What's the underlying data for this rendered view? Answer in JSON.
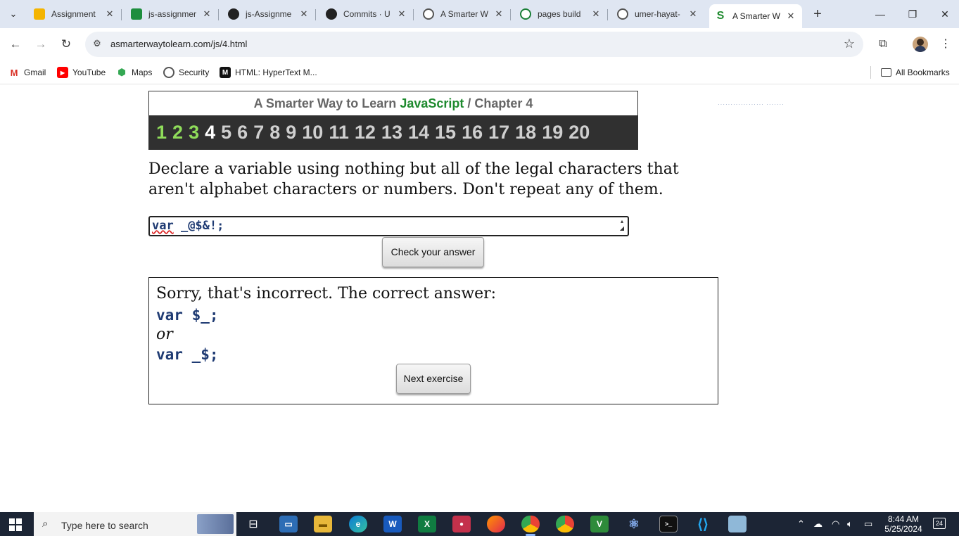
{
  "tabs": [
    {
      "title": "Assignment",
      "icon": "google-classroom-icon",
      "color": "#f4b400"
    },
    {
      "title": "js-assignmer",
      "icon": "google-classroom-icon",
      "color": "#1e8e3e"
    },
    {
      "title": "js-Assignme",
      "icon": "github-icon",
      "color": "#222222"
    },
    {
      "title": "Commits · U",
      "icon": "github-icon",
      "color": "#222222"
    },
    {
      "title": "A Smarter W",
      "icon": "globe-icon",
      "color": "#555555"
    },
    {
      "title": "pages build",
      "icon": "github-actions-icon",
      "color": "#1a7f37"
    },
    {
      "title": "umer-hayat-",
      "icon": "globe-icon",
      "color": "#555555"
    },
    {
      "title": "A Smarter W",
      "icon": "smarter-way-s-icon",
      "color": "#1e8a2e"
    }
  ],
  "browser": {
    "url": "asmarterwaytolearn.com/js/4.html"
  },
  "bookmarks": [
    {
      "label": "Gmail",
      "icon": "gmail-icon"
    },
    {
      "label": "YouTube",
      "icon": "youtube-icon"
    },
    {
      "label": "Maps",
      "icon": "maps-icon"
    },
    {
      "label": "Security",
      "icon": "globe-icon"
    },
    {
      "label": "HTML: HyperText M...",
      "icon": "mdn-icon"
    }
  ],
  "all_bookmarks": "All Bookmarks",
  "chapter": {
    "title_prefix": "A Smarter Way to Learn",
    "title_js": "JavaScript",
    "title_suffix": "/  Chapter 4",
    "numbers": [
      "1",
      "2",
      "3",
      "4",
      "5",
      "6",
      "7",
      "8",
      "9",
      "10",
      "11",
      "12",
      "13",
      "14",
      "15",
      "16",
      "17",
      "18",
      "19",
      "20"
    ],
    "completed": 3,
    "current": 4
  },
  "exercise": {
    "question": "Declare a variable using nothing but all of the legal characters that aren't alphabet characters or numbers. Don't repeat any of them.",
    "input_kw": "var",
    "input_rest": " _@$&!;",
    "check_label": "Check your answer"
  },
  "feedback": {
    "message": "Sorry, that's incorrect. The correct answer:",
    "answer1": "var $_;",
    "or": "or",
    "answer2": "var _$;",
    "next_label": "Next exercise"
  },
  "taskbar": {
    "search_placeholder": "Type here to search",
    "time": "8:44 AM",
    "date": "5/25/2024",
    "notifications": "24"
  }
}
